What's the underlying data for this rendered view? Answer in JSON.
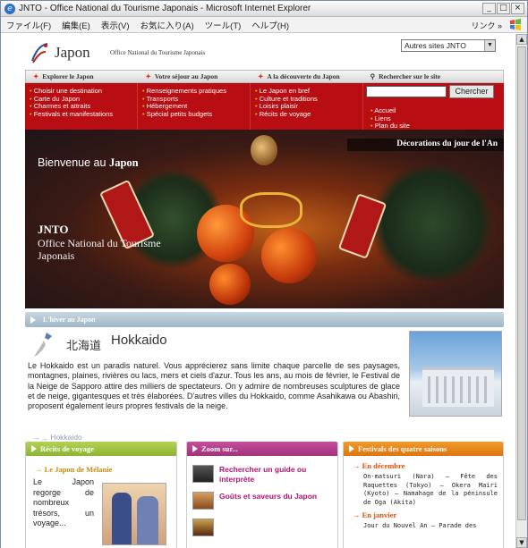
{
  "window": {
    "title": "JNTO - Office National du Tourisme Japonais - Microsoft Internet Explorer",
    "controls": [
      "_",
      "□",
      "×"
    ]
  },
  "menubar": {
    "items": [
      "ファイル(F)",
      "編集(E)",
      "表示(V)",
      "お気に入り(A)",
      "ツール(T)",
      "ヘルプ(H)"
    ],
    "links_label": "リンク »"
  },
  "site": {
    "logo_text": "Japon",
    "logo_sub": "Office National du Tourisme Japonais",
    "site_select": "Autres sites JNTO",
    "nav": [
      "Explorer le Japon",
      "Votre séjour au Japon",
      "A la découverte du Japon",
      "Rechercher sur le site"
    ],
    "menu_cols": [
      [
        "Choisir une destination",
        "Carte du Japon",
        "Charmes et attraits",
        "Festivals et manifestations"
      ],
      [
        "Renseignements pratiques",
        "Transports",
        "Hébergement",
        "Spécial petits budgets"
      ],
      [
        "Le Japon en bref",
        "Culture et traditions",
        "Loisirs plaisir",
        "Récits de voyage"
      ]
    ],
    "search_button": "Chercher",
    "search_links": [
      "Accueil",
      "Liens",
      "Plan du site"
    ]
  },
  "hero": {
    "title": "Décorations du jour de l'An",
    "welcome_prefix": "Bienvenue au ",
    "welcome_bold": "Japon",
    "jnto": "JNTO",
    "org": "Office National du Tourisme Japonais"
  },
  "winter": {
    "bar": "L'hiver au Japon",
    "jp_name": "北海道",
    "name": "Hokkaido",
    "text": "Le Hokkaido est un paradis naturel. Vous apprécierez sans limite chaque parcelle de ses paysages, montagnes, plaines, rivières ou lacs, mers et ciels d'azur. Tous les ans, au mois de février, le Festival de la Neige de Sapporo attire des milliers de spectateurs. On y admire de nombreuses sculptures de glace et de neige, gigantesques et très élaborées. D'autres villes du Hokkaido, comme Asahikawa ou Abashiri, proposent également leurs propres festivals de la neige.",
    "more": "→ ... Hokkaido"
  },
  "boxes": {
    "recits": {
      "title": "Récits de voyage",
      "sub": "Le Japon de Mélanie",
      "desc": "Le Japon regorge de nombreux trésors, un voyage..."
    },
    "zoom": {
      "title": "Zoom sur...",
      "items": [
        "Rechercher un guide ou interprète",
        "Goûts et saveurs du Japon"
      ]
    },
    "festivals": {
      "title": "Festivals des quatre saisons",
      "dec": "En décembre",
      "dec_text": "On-matsuri (Nara) — Fête des Raquettes (Tokyo) — Okera Mairi (Kyoto) — Namahage de la péninsule de Oga (Akita)",
      "jan": "En janvier",
      "jan_text": "Jour du Nouvel An — Parade des"
    }
  },
  "colors": {
    "nav_red": "#b80d12",
    "accent_orange": "#df7410",
    "accent_green": "#8db430",
    "accent_magenta": "#a3307a",
    "winter_blue": "#9fb6c6"
  }
}
